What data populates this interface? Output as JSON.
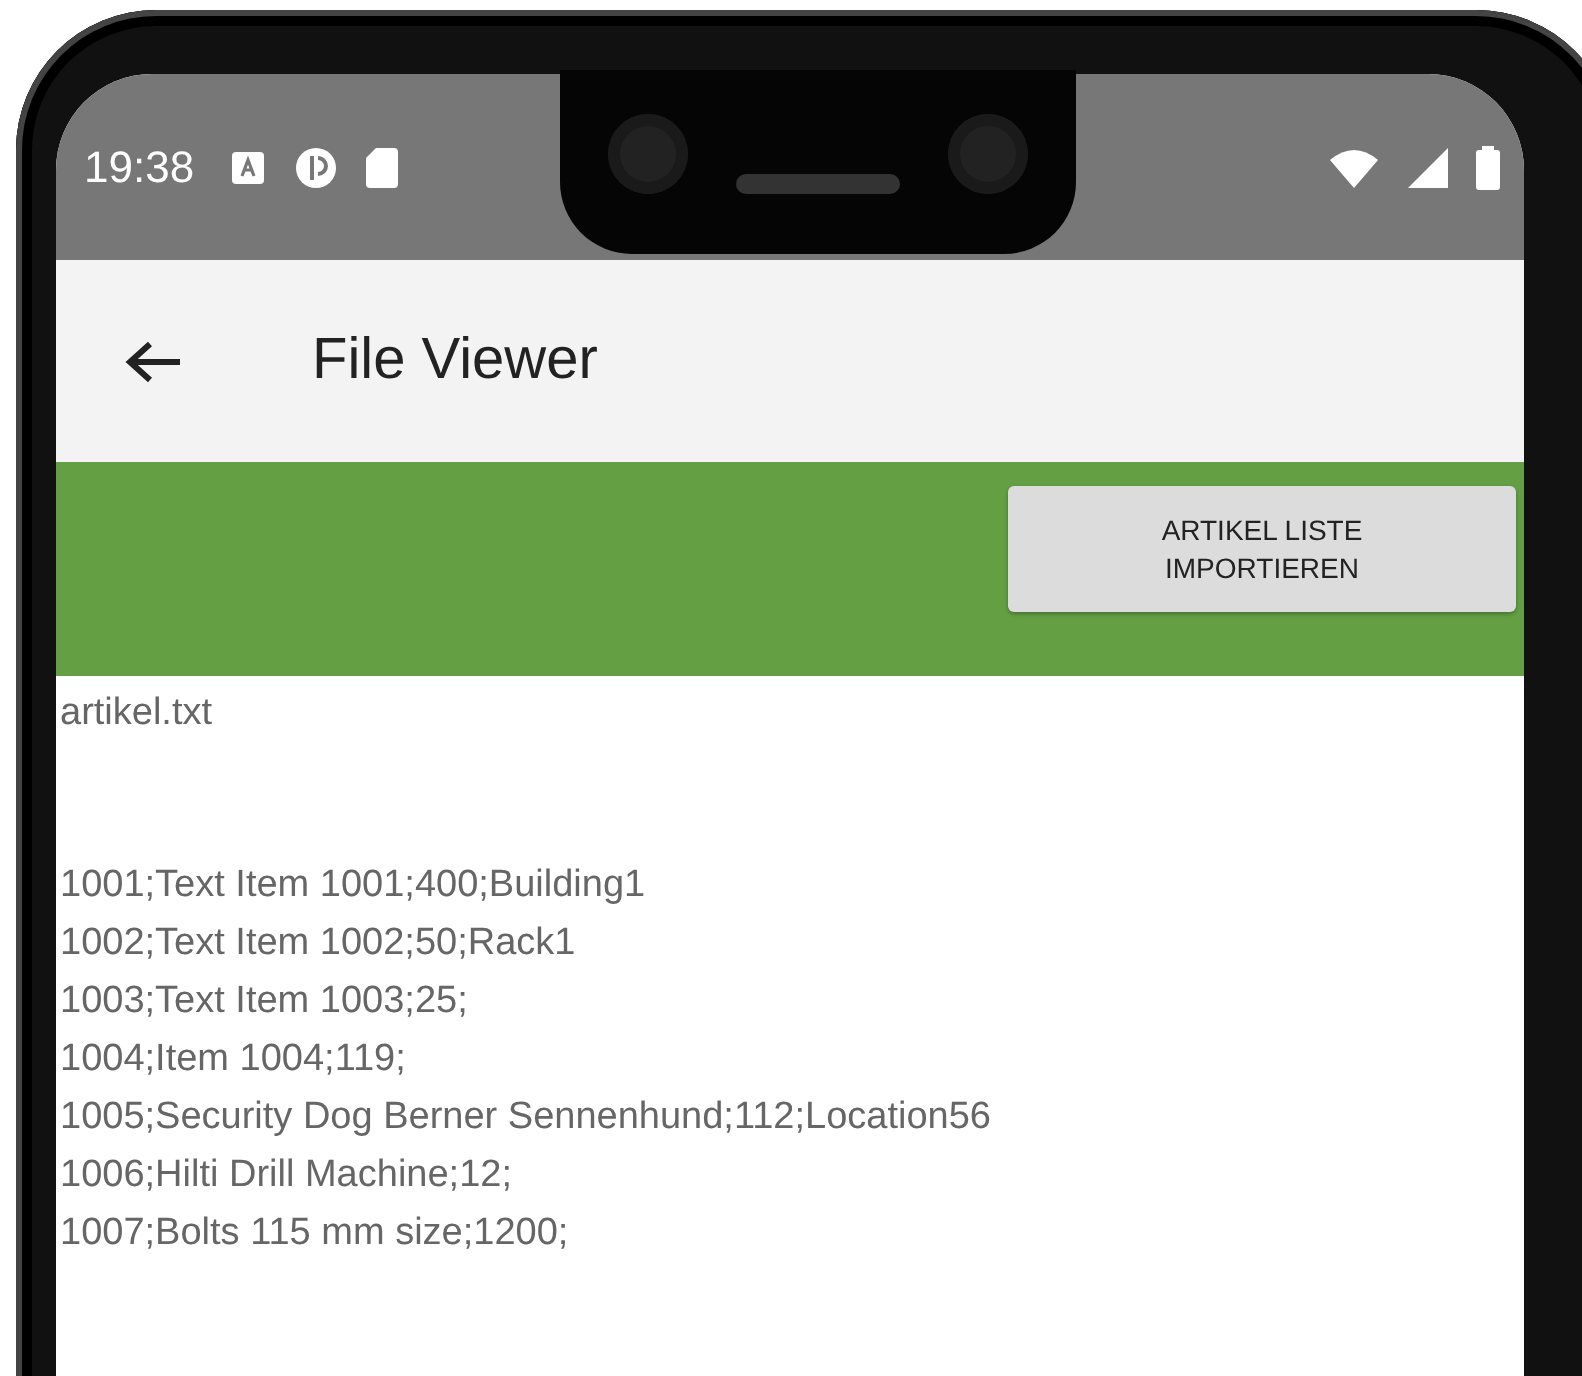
{
  "status_bar": {
    "time": "19:38"
  },
  "app_bar": {
    "title": "File Viewer"
  },
  "toolbar": {
    "button": "ARTIKEL LISTE IMPORTIEREN"
  },
  "file": {
    "name": "artikel.txt",
    "lines": [
      "1001;Text Item 1001;400;Building1",
      "1002;Text Item 1002;50;Rack1",
      "1003;Text Item 1003;25;",
      "1004;Item 1004;119;",
      "1005;Security Dog Berner Sennenhund;112;Location56",
      "1006;Hilti Drill Machine;12;",
      "1007;Bolts 115 mm size;1200;"
    ]
  }
}
